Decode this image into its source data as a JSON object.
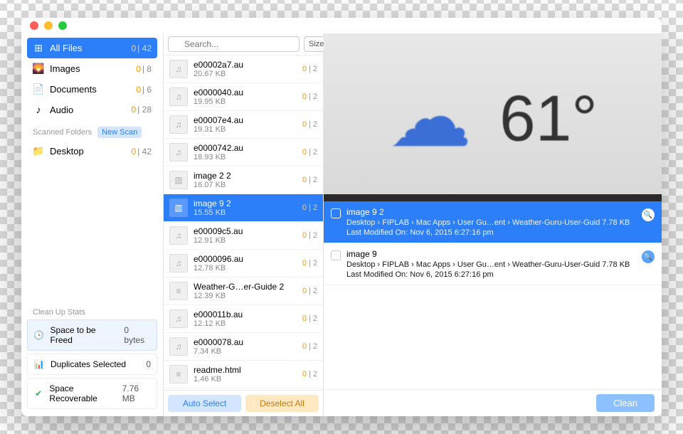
{
  "search": {
    "placeholder": "Search..."
  },
  "sort": {
    "label": "Size"
  },
  "sidebar": {
    "categories": [
      {
        "icon": "grid",
        "label": "All Files",
        "sel": 0,
        "total": 42,
        "selected": true
      },
      {
        "icon": "image",
        "label": "Images",
        "sel": 0,
        "total": 8
      },
      {
        "icon": "doc",
        "label": "Documents",
        "sel": 0,
        "total": 6
      },
      {
        "icon": "audio",
        "label": "Audio",
        "sel": 0,
        "total": 28
      }
    ],
    "scanned_label": "Scanned Folders",
    "new_scan": "New Scan",
    "folders": [
      {
        "icon": "folder",
        "label": "Desktop",
        "sel": 0,
        "total": 42
      }
    ],
    "stats_title": "Clean Up Stats",
    "stats": {
      "freed_label": "Space to be Freed",
      "freed_value": "0 bytes",
      "dup_label": "Duplicates Selected",
      "dup_value": "0",
      "rec_label": "Space Recoverable",
      "rec_value": "7.76 MB"
    }
  },
  "list": [
    {
      "name": "e00002a7.au",
      "size": "20.67 KB",
      "a": 0,
      "b": 2,
      "kind": "audio"
    },
    {
      "name": "e0000040.au",
      "size": "19.95 KB",
      "a": 0,
      "b": 2,
      "kind": "audio"
    },
    {
      "name": "e00007e4.au",
      "size": "19.31 KB",
      "a": 0,
      "b": 2,
      "kind": "audio"
    },
    {
      "name": "e0000742.au",
      "size": "18.93 KB",
      "a": 0,
      "b": 2,
      "kind": "audio"
    },
    {
      "name": "image 2 2",
      "size": "16.07 KB",
      "a": 0,
      "b": 2,
      "kind": "image"
    },
    {
      "name": "image 9 2",
      "size": "15.55 KB",
      "a": 0,
      "b": 2,
      "kind": "image",
      "selected": true
    },
    {
      "name": "e00009c5.au",
      "size": "12.91 KB",
      "a": 0,
      "b": 2,
      "kind": "audio"
    },
    {
      "name": "e0000096.au",
      "size": "12.78 KB",
      "a": 0,
      "b": 2,
      "kind": "audio"
    },
    {
      "name": "Weather-G…er-Guide 2",
      "size": "12.39 KB",
      "a": 0,
      "b": 2,
      "kind": "doc"
    },
    {
      "name": "e000011b.au",
      "size": "12.12 KB",
      "a": 0,
      "b": 2,
      "kind": "audio"
    },
    {
      "name": "e0000078.au",
      "size": "7.34 KB",
      "a": 0,
      "b": 2,
      "kind": "audio"
    },
    {
      "name": "readme.html",
      "size": "1.46 KB",
      "a": 0,
      "b": 2,
      "kind": "doc"
    }
  ],
  "actions": {
    "auto": "Auto Select",
    "deselect": "Deselect All",
    "clean": "Clean"
  },
  "preview": {
    "temp": "61°"
  },
  "details": [
    {
      "name": "image 9 2",
      "path": "Desktop › FIPLAB › Mac Apps › User Gu…ent › Weather-Guru-User-Guid",
      "size": "7.78 KB",
      "modified": "Last Modified On: Nov 6, 2015 6:27:16 pm",
      "selected": true
    },
    {
      "name": "image 9",
      "path": "Desktop › FIPLAB › Mac Apps › User Gu…ent › Weather-Guru-User-Guid",
      "size": "7.78 KB",
      "modified": "Last Modified On: Nov 6, 2015 6:27:16 pm"
    }
  ]
}
